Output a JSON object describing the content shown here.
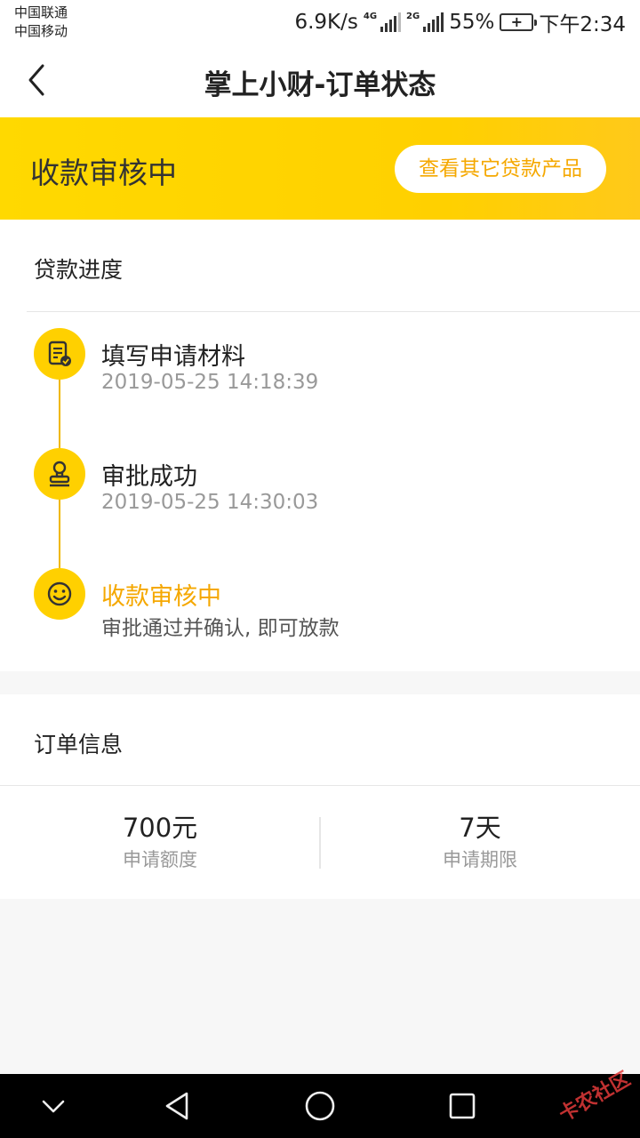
{
  "status_bar": {
    "carrier_1": "中国联通",
    "carrier_2": "中国移动",
    "speed": "6.9K/s",
    "sim1_tag": "4G",
    "sim2_tag": "2G",
    "battery_percent": "55%",
    "time": "下午2:34"
  },
  "nav": {
    "title": "掌上小财-订单状态",
    "back_icon": "chevron-left-icon"
  },
  "banner": {
    "status": "收款审核中",
    "other_products_button": "查看其它贷款产品"
  },
  "progress": {
    "section_title": "贷款进度",
    "steps": [
      {
        "title": "填写申请材料",
        "subtitle": "2019-05-25 14:18:39",
        "icon": "document-check-icon",
        "active": false
      },
      {
        "title": "审批成功",
        "subtitle": "2019-05-25 14:30:03",
        "icon": "stamp-icon",
        "active": false
      },
      {
        "title": "收款审核中",
        "subtitle": "审批通过并确认, 即可放款",
        "icon": "smiley-icon",
        "active": true
      }
    ]
  },
  "order": {
    "section_title": "订单信息",
    "amount_value": "700元",
    "amount_label": "申请额度",
    "term_value": "7天",
    "term_label": "申请期限"
  },
  "colors": {
    "accent_yellow": "#ffd000",
    "accent_orange_text": "#f5a800",
    "timeline": "#f0b800"
  },
  "watermark": "卡农社区"
}
